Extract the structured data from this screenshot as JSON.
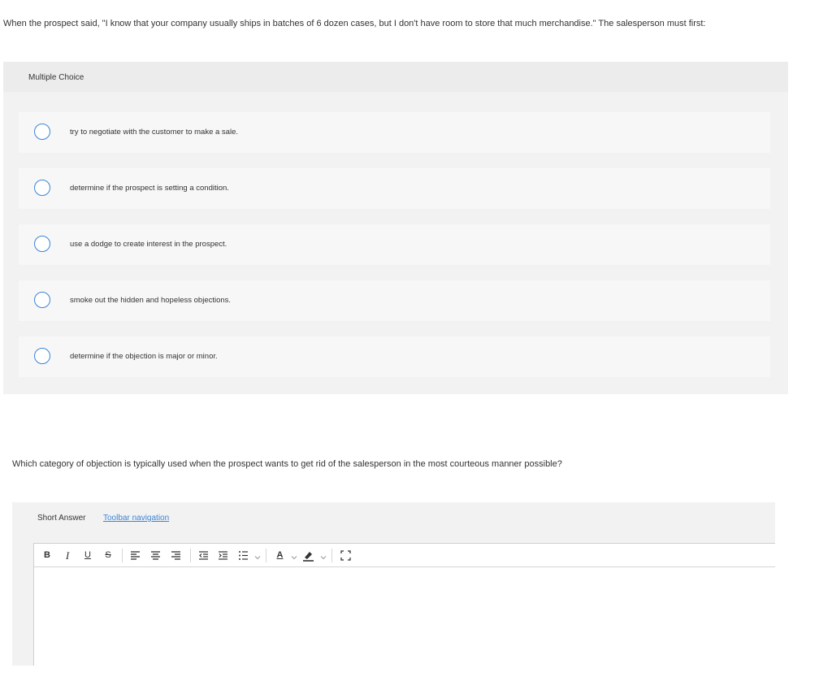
{
  "question1": {
    "text": "When the prospect said, \"I know that your company usually ships in batches of 6 dozen cases, but I don't have room to store that much merchandise.\" The salesperson must first:",
    "type_label": "Multiple Choice",
    "options": [
      {
        "label": "try to negotiate with the customer to make a sale.",
        "selected": false
      },
      {
        "label": "determine if the prospect is setting a condition.",
        "selected": false
      },
      {
        "label": "use a dodge to create interest in the prospect.",
        "selected": false
      },
      {
        "label": "smoke out the hidden and hopeless objections.",
        "selected": false
      },
      {
        "label": "determine if the objection is major or minor.",
        "selected": false
      }
    ]
  },
  "question2": {
    "text": "Which category of objection is typically used when the prospect wants to get rid of the salesperson in the most courteous manner possible?",
    "type_label": "Short Answer",
    "toolbar_nav_link": "Toolbar navigation",
    "toolbar": {
      "bold": "B",
      "italic": "I",
      "underline": "U",
      "strikethrough": "S",
      "font_color": "A"
    },
    "answer_value": ""
  },
  "colors": {
    "accent": "#3b84d6",
    "panel_bg": "#f2f2f2",
    "option_bg": "#f7f7f7"
  },
  "icons": {
    "align_left": "align-left-icon",
    "align_center": "align-center-icon",
    "align_right": "align-right-icon",
    "outdent": "outdent-icon",
    "indent": "indent-icon",
    "bullet_list": "bullet-list-icon",
    "highlight": "highlighter-icon",
    "fullscreen": "fullscreen-icon"
  }
}
